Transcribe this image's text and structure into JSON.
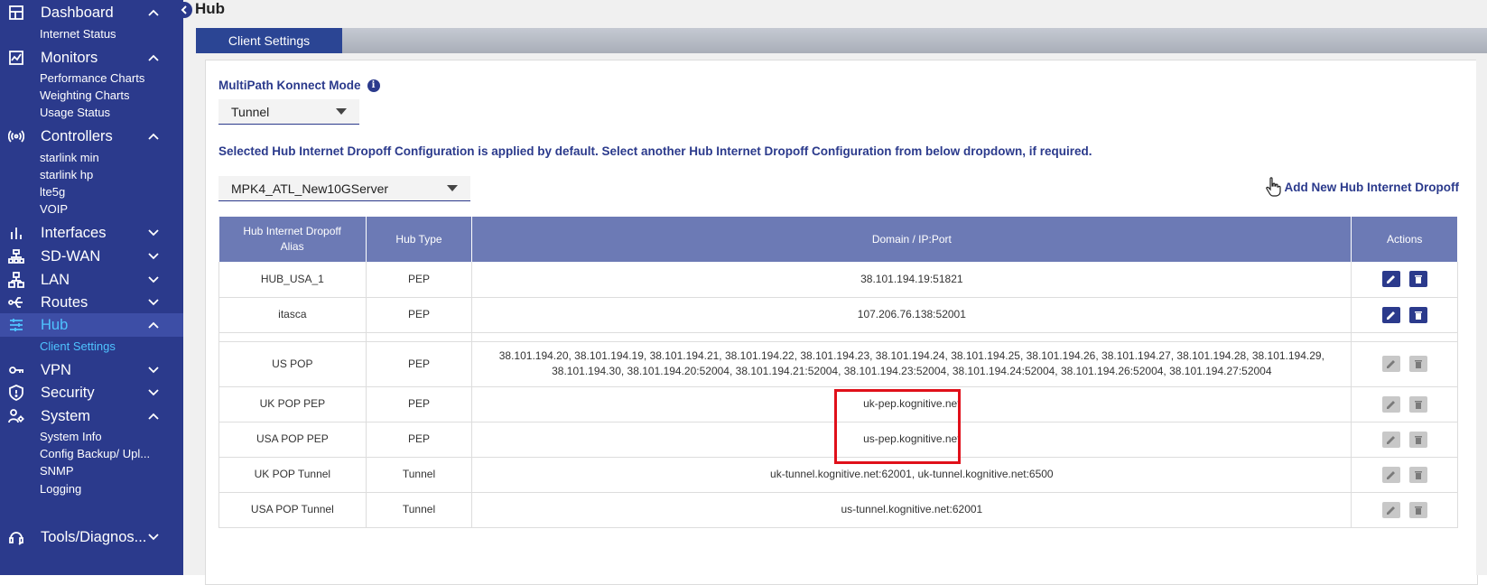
{
  "sidebar": {
    "sections": [
      {
        "label": "Dashboard",
        "icon": "dashboard-icon",
        "expanded": true,
        "items": [
          "Internet Status"
        ]
      },
      {
        "label": "Monitors",
        "icon": "monitors-icon",
        "expanded": true,
        "items": [
          "Performance Charts",
          "Weighting Charts",
          "Usage Status"
        ]
      },
      {
        "label": "Controllers",
        "icon": "controllers-icon",
        "expanded": true,
        "items": [
          "starlink min",
          "starlink hp",
          "lte5g",
          "VOIP"
        ]
      },
      {
        "label": "Interfaces",
        "icon": "interfaces-icon",
        "expanded": false
      },
      {
        "label": "SD-WAN",
        "icon": "sdwan-icon",
        "expanded": false
      },
      {
        "label": "LAN",
        "icon": "lan-icon",
        "expanded": false
      },
      {
        "label": "Routes",
        "icon": "routes-icon",
        "expanded": false
      },
      {
        "label": "Hub",
        "icon": "hub-icon",
        "expanded": true,
        "active": true,
        "items": [
          "Client Settings"
        ]
      },
      {
        "label": "VPN",
        "icon": "vpn-icon",
        "expanded": false
      },
      {
        "label": "Security",
        "icon": "security-icon",
        "expanded": false
      },
      {
        "label": "System",
        "icon": "system-icon",
        "expanded": true,
        "items": [
          "System Info",
          "Config Backup/ Upl...",
          "SNMP",
          "Logging"
        ]
      },
      {
        "label": "Tools/Diagnos...",
        "icon": "tools-icon",
        "expanded": false
      }
    ]
  },
  "page": {
    "title": "Hub",
    "tab": "Client Settings"
  },
  "form": {
    "mode_label": "MultiPath Konnect Mode",
    "mode_value": "Tunnel",
    "notice": "Selected Hub Internet Dropoff Configuration is applied by default. Select another Hub Internet Dropoff Configuration from below dropdown, if required.",
    "config_value": "MPK4_ATL_New10GServer",
    "add_link": "Add New Hub Internet Dropoff"
  },
  "table": {
    "headers": {
      "alias_line1": "Hub Internet Dropoff",
      "alias_line2": "Alias",
      "type": "Hub Type",
      "domain": "Domain / IP:Port",
      "actions": "Actions"
    },
    "rows": [
      {
        "alias": "HUB_USA_1",
        "type": "PEP",
        "domain": "38.101.194.19:51821",
        "enabled": true
      },
      {
        "alias": "itasca",
        "type": "PEP",
        "domain": "107.206.76.138:52001",
        "enabled": true
      },
      {
        "alias": "US POP",
        "type": "PEP",
        "domain": "38.101.194.20, 38.101.194.19, 38.101.194.21, 38.101.194.22, 38.101.194.23, 38.101.194.24, 38.101.194.25, 38.101.194.26, 38.101.194.27, 38.101.194.28, 38.101.194.29, 38.101.194.30, 38.101.194.20:52004, 38.101.194.21:52004, 38.101.194.23:52004, 38.101.194.24:52004, 38.101.194.26:52004, 38.101.194.27:52004",
        "enabled": false
      },
      {
        "alias": "UK POP PEP",
        "type": "PEP",
        "domain": "uk-pep.kognitive.net",
        "enabled": false
      },
      {
        "alias": "USA POP PEP",
        "type": "PEP",
        "domain": "us-pep.kognitive.net",
        "enabled": false
      },
      {
        "alias": "UK POP Tunnel",
        "type": "Tunnel",
        "domain": "uk-tunnel.kognitive.net:62001, uk-tunnel.kognitive.net:6500",
        "enabled": false
      },
      {
        "alias": "USA POP Tunnel",
        "type": "Tunnel",
        "domain": "us-tunnel.kognitive.net:62001",
        "enabled": false
      }
    ]
  },
  "colors": {
    "sidebar_bg": "#2b3a8c",
    "active_text": "#4fc3ff",
    "table_header": "#6c7ab5",
    "highlight": "#e0101a"
  }
}
